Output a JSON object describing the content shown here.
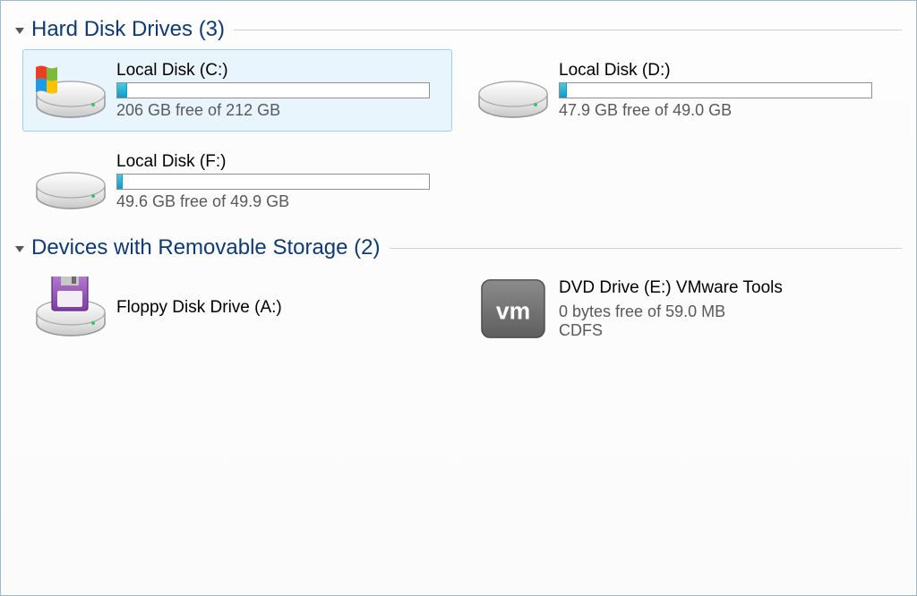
{
  "groups": [
    {
      "title": "Hard Disk Drives (3)",
      "items": [
        {
          "name": "Local Disk (C:)",
          "free_text": "206 GB free of 212 GB",
          "used_pct": 3,
          "has_bar": true,
          "selected": true,
          "icon": "drive-os"
        },
        {
          "name": "Local Disk (D:)",
          "free_text": "47.9 GB free of 49.0 GB",
          "used_pct": 2,
          "has_bar": true,
          "selected": false,
          "icon": "drive"
        },
        {
          "name": "Local Disk (F:)",
          "free_text": "49.6 GB free of 49.9 GB",
          "used_pct": 1,
          "has_bar": true,
          "selected": false,
          "icon": "drive"
        }
      ]
    },
    {
      "title": "Devices with Removable Storage (2)",
      "items": [
        {
          "name": "Floppy Disk Drive (A:)",
          "free_text": "",
          "has_bar": false,
          "selected": false,
          "icon": "floppy"
        },
        {
          "name": "DVD Drive (E:) VMware Tools",
          "free_text": "0 bytes free of 59.0 MB",
          "fs": "CDFS",
          "has_bar": false,
          "selected": false,
          "icon": "vmware"
        }
      ]
    }
  ]
}
